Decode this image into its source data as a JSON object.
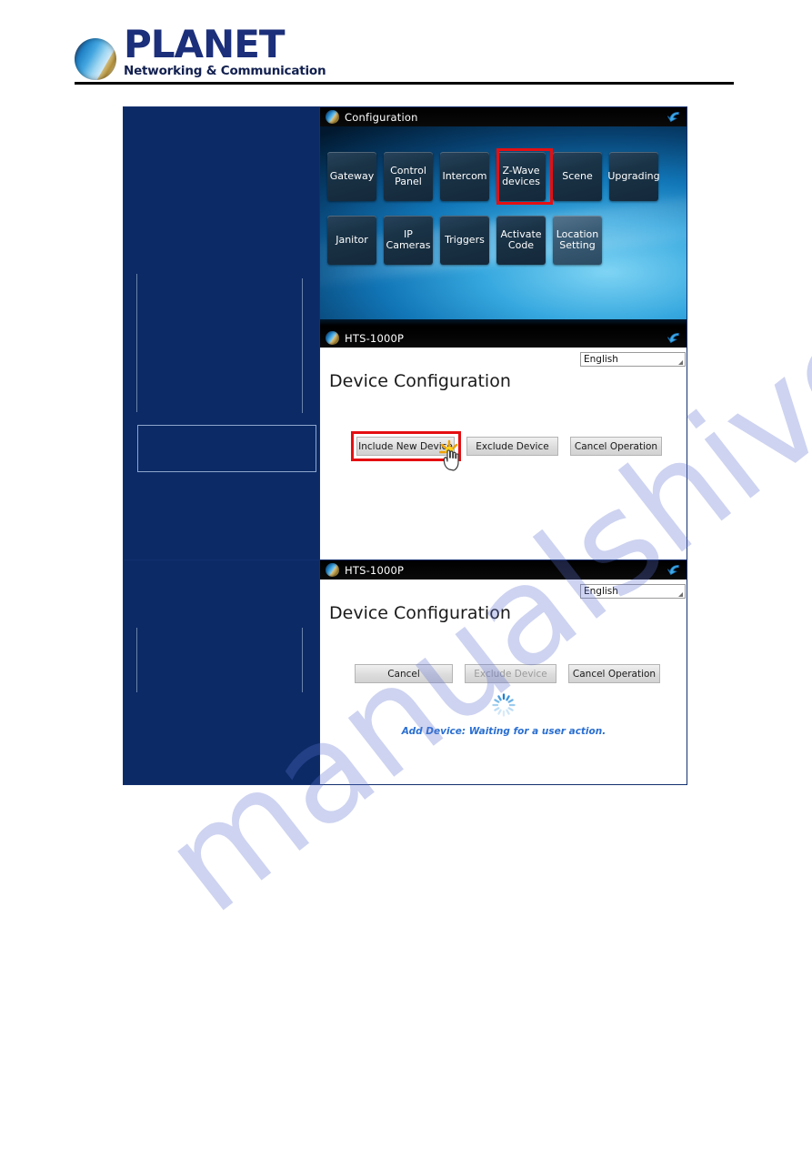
{
  "document": {
    "brand_name": "PLANET",
    "brand_tagline": "Networking & Communication",
    "watermark": "manualshive.com",
    "accent_highlight_color": "#e50f12",
    "redaction_color": "#0b2a66"
  },
  "panels": {
    "configuration": {
      "titlebar": {
        "title": "Configuration",
        "back_icon": "back-arrow-icon",
        "logo_icon": "planet-globe-icon"
      },
      "tiles_row1": [
        {
          "label": "Gateway",
          "style": "dark",
          "highlighted": false
        },
        {
          "label": "Control Panel",
          "style": "dark",
          "highlighted": false
        },
        {
          "label": "Intercom",
          "style": "dark",
          "highlighted": false
        },
        {
          "label": "Z-Wave devices",
          "style": "dark",
          "highlighted": true
        },
        {
          "label": "Scene",
          "style": "dark",
          "highlighted": false
        },
        {
          "label": "Upgrading",
          "style": "dark",
          "highlighted": false
        }
      ],
      "tiles_row2": [
        {
          "label": "Janitor",
          "style": "dark",
          "highlighted": false
        },
        {
          "label": "IP Cameras",
          "style": "dark",
          "highlighted": false
        },
        {
          "label": "Triggers",
          "style": "dark",
          "highlighted": false
        },
        {
          "label": "Activate Code",
          "style": "dark",
          "highlighted": false
        },
        {
          "label": "Location Setting",
          "style": "light",
          "highlighted": false
        }
      ]
    },
    "device_config_step1": {
      "titlebar": {
        "title": "HTS-1000P",
        "back_icon": "back-arrow-icon",
        "logo_icon": "planet-globe-icon"
      },
      "language": {
        "value": "English",
        "icon": "chevron-down-icon"
      },
      "heading": "Device Configuration",
      "buttons": [
        {
          "label": "Include New Device",
          "disabled": false,
          "highlighted": true
        },
        {
          "label": "Exclude Device",
          "disabled": false,
          "highlighted": false
        },
        {
          "label": "Cancel Operation",
          "disabled": false,
          "highlighted": false
        }
      ],
      "cursor_icon": "hand-pointer-click-icon"
    },
    "device_config_step2": {
      "titlebar": {
        "title": "HTS-1000P",
        "back_icon": "back-arrow-icon",
        "logo_icon": "planet-globe-icon"
      },
      "language": {
        "value": "English",
        "icon": "chevron-down-icon"
      },
      "heading": "Device Configuration",
      "buttons": [
        {
          "label": "Cancel",
          "disabled": false,
          "highlighted": false
        },
        {
          "label": "Exclude Device",
          "disabled": true,
          "highlighted": false
        },
        {
          "label": "Cancel Operation",
          "disabled": false,
          "highlighted": false
        }
      ],
      "spinner_icon": "loading-spinner-icon",
      "status_text": "Add Device: Waiting for a user action."
    }
  }
}
